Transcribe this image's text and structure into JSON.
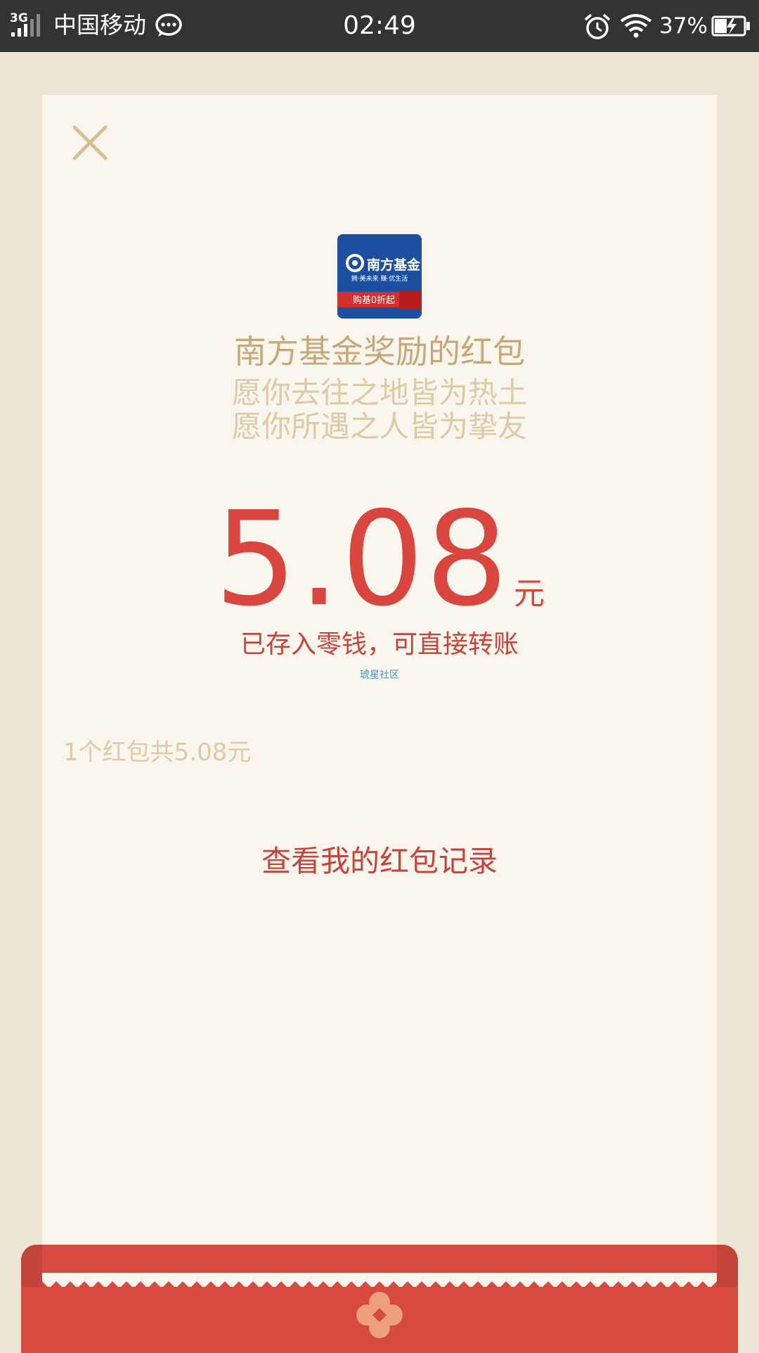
{
  "status_bar": {
    "network": "3G",
    "carrier": "中国移动",
    "time": "02:49",
    "battery_percent": "37%",
    "icons": [
      "signal-icon",
      "message-icon",
      "alarm-icon",
      "wifi-icon",
      "battery-charging-icon"
    ]
  },
  "red_packet": {
    "sender_title": "南方基金奖励的红包",
    "wish_line_1": "愿你去往之地皆为热土",
    "wish_line_2": "愿你所遇之人皆为挚友",
    "amount": "5.08",
    "unit": "元",
    "saved_note": "已存入零钱，可直接转账",
    "watermark": "琥星社区",
    "total_summary": "1个红包共5.08元",
    "records_link": "查看我的红包记录"
  },
  "logo": {
    "brand": "南方基金",
    "slogan": "拥·美未来 赚·优生活",
    "banner": "购基0折起"
  },
  "colors": {
    "status_bar_bg": "#333333",
    "page_bg": "#ede5d5",
    "card_bg": "#faf6ed",
    "gold_text": "#c6a87a",
    "light_gold_text": "#dccba8",
    "red_text": "#d9463f",
    "envelope_red": "#d74a3f"
  }
}
